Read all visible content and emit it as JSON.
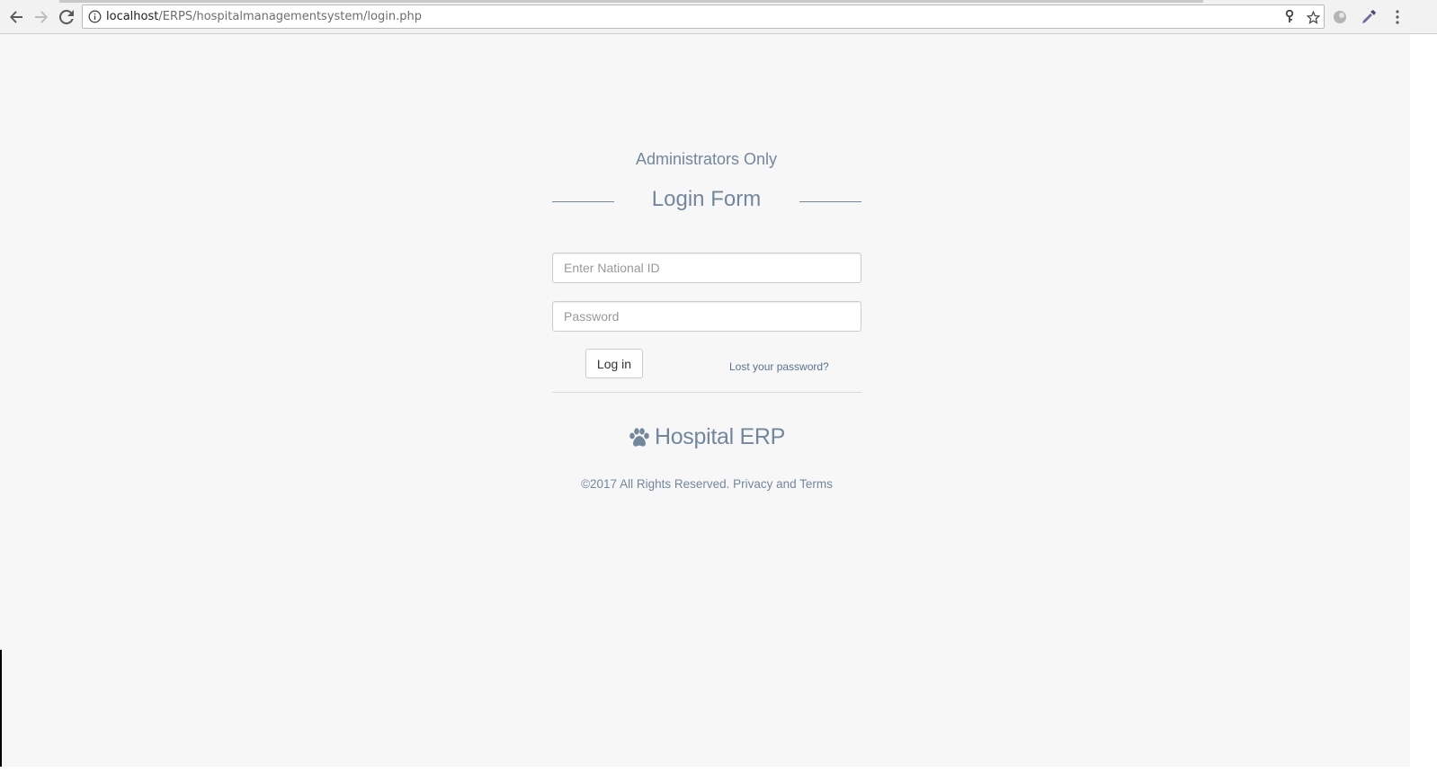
{
  "browser": {
    "url_host": "localhost",
    "url_path": "/ERPS/hospitalmanagementsystem/login.php",
    "icons": [
      "back-arrow-icon",
      "forward-arrow-icon",
      "reload-icon",
      "info-icon",
      "key-icon",
      "star-icon",
      "extension-icon",
      "eyedropper-icon",
      "menu-dots-icon"
    ]
  },
  "page": {
    "subtitle": "Administrators Only",
    "form_title": "Login Form",
    "national_id_placeholder": "Enter National ID",
    "national_id_value": "",
    "password_placeholder": "Password",
    "password_value": "",
    "login_button": "Log in",
    "lost_password_link": "Lost your password?",
    "brand_name": "Hospital ERP",
    "brand_icon": "paw-icon",
    "copyright": "©2017 All Rights Reserved. Privacy and Terms"
  },
  "colors": {
    "page_bg": "#f7f7f7",
    "text_muted": "#73879c",
    "link": "#5a738e"
  }
}
